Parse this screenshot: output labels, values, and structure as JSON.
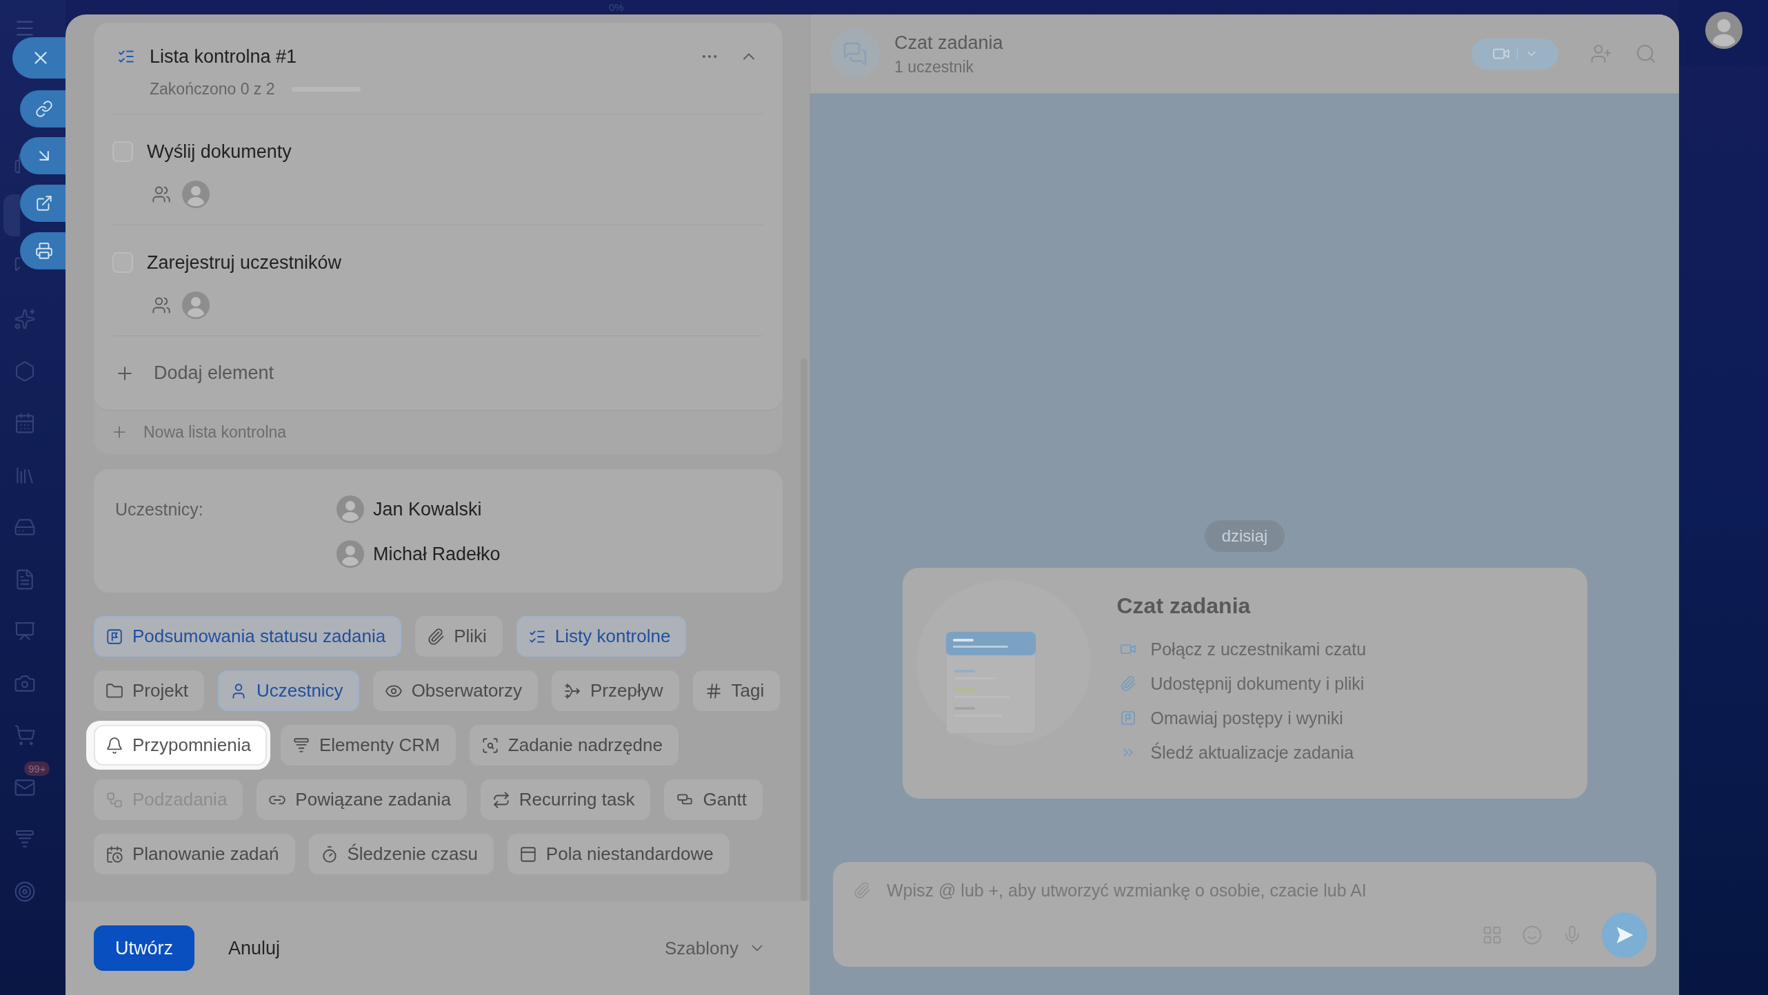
{
  "top_strip": {
    "progress_text": "0%"
  },
  "sidebar": {
    "items": [
      {
        "selected": false
      },
      {
        "selected": true
      },
      {
        "selected": false
      },
      {
        "selected": false
      },
      {
        "selected": false
      },
      {
        "selected": false
      },
      {
        "selected": false
      },
      {
        "selected": false
      },
      {
        "selected": false
      },
      {
        "selected": false
      },
      {
        "selected": false
      },
      {
        "selected": false
      },
      {
        "selected": false,
        "badge": "99+"
      },
      {
        "selected": false
      },
      {
        "selected": false
      }
    ]
  },
  "checklist": {
    "title": "Lista kontrolna #1",
    "progress_text": "Zakończono 0 z 2",
    "level": 0,
    "items": [
      {
        "label": "Wyślij dokumenty",
        "checked": false
      },
      {
        "label": "Zarejestruj uczestników",
        "checked": false
      }
    ],
    "add_item": "Dodaj element",
    "new_checklist": "Nowa lista kontrolna"
  },
  "participants": {
    "label": "Uczestnicy:",
    "people": [
      {
        "name": "Jan Kowalski"
      },
      {
        "name": "Michał Radełko"
      }
    ]
  },
  "feature_rows": [
    {
      "buttons": [
        {
          "label": "Podsumowania statusu zadania",
          "selected": true,
          "disabled": false,
          "highlighted": false
        },
        {
          "label": "Pliki",
          "selected": false,
          "disabled": false,
          "highlighted": false
        },
        {
          "label": "Listy kontrolne",
          "selected": true,
          "disabled": false,
          "highlighted": false
        }
      ]
    },
    {
      "buttons": [
        {
          "label": "Projekt",
          "selected": false,
          "disabled": false,
          "highlighted": false
        },
        {
          "label": "Uczestnicy",
          "selected": true,
          "disabled": false,
          "highlighted": false
        },
        {
          "label": "Obserwatorzy",
          "selected": false,
          "disabled": false,
          "highlighted": false
        },
        {
          "label": "Przepływ",
          "selected": false,
          "disabled": false,
          "highlighted": false
        },
        {
          "label": "Tagi",
          "selected": false,
          "disabled": false,
          "highlighted": false
        }
      ]
    },
    {
      "buttons": [
        {
          "label": "Przypomnienia",
          "selected": false,
          "disabled": false,
          "highlighted": true
        },
        {
          "label": "Elementy CRM",
          "selected": false,
          "disabled": false,
          "highlighted": false
        },
        {
          "label": "Zadanie nadrzędne",
          "selected": false,
          "disabled": false,
          "highlighted": false
        }
      ]
    },
    {
      "buttons": [
        {
          "label": "Podzadania",
          "selected": false,
          "disabled": true,
          "highlighted": false
        },
        {
          "label": "Powiązane zadania",
          "selected": false,
          "disabled": false,
          "highlighted": false
        },
        {
          "label": "Recurring task",
          "selected": false,
          "disabled": false,
          "highlighted": false
        },
        {
          "label": "Gantt",
          "selected": false,
          "disabled": false,
          "highlighted": false
        }
      ]
    },
    {
      "buttons": [
        {
          "label": "Planowanie zadań",
          "selected": false,
          "disabled": false,
          "highlighted": false
        },
        {
          "label": "Śledzenie czasu",
          "selected": false,
          "disabled": false,
          "highlighted": false
        },
        {
          "label": "Pola niestandardowe",
          "selected": false,
          "disabled": false,
          "highlighted": false
        }
      ]
    }
  ],
  "footer": {
    "create_button": "Utwórz",
    "cancel_button": "Anuluj",
    "templates_button": "Szablony"
  },
  "chat": {
    "title": "Czat zadania",
    "subtitle": "1 uczestnik",
    "date_chip": "dzisiaj",
    "intro": {
      "title": "Czat zadania",
      "points": [
        "Połącz z uczestnikami czatu",
        "Udostępnij dokumenty i pliki",
        "Omawiaj postępy i wyniki",
        "Śledź aktualizacje zadania"
      ]
    },
    "input": {
      "placeholder": "Wpisz @ lub +, aby utworzyć wzmiankę o osobie, czacie lub AI"
    }
  }
}
